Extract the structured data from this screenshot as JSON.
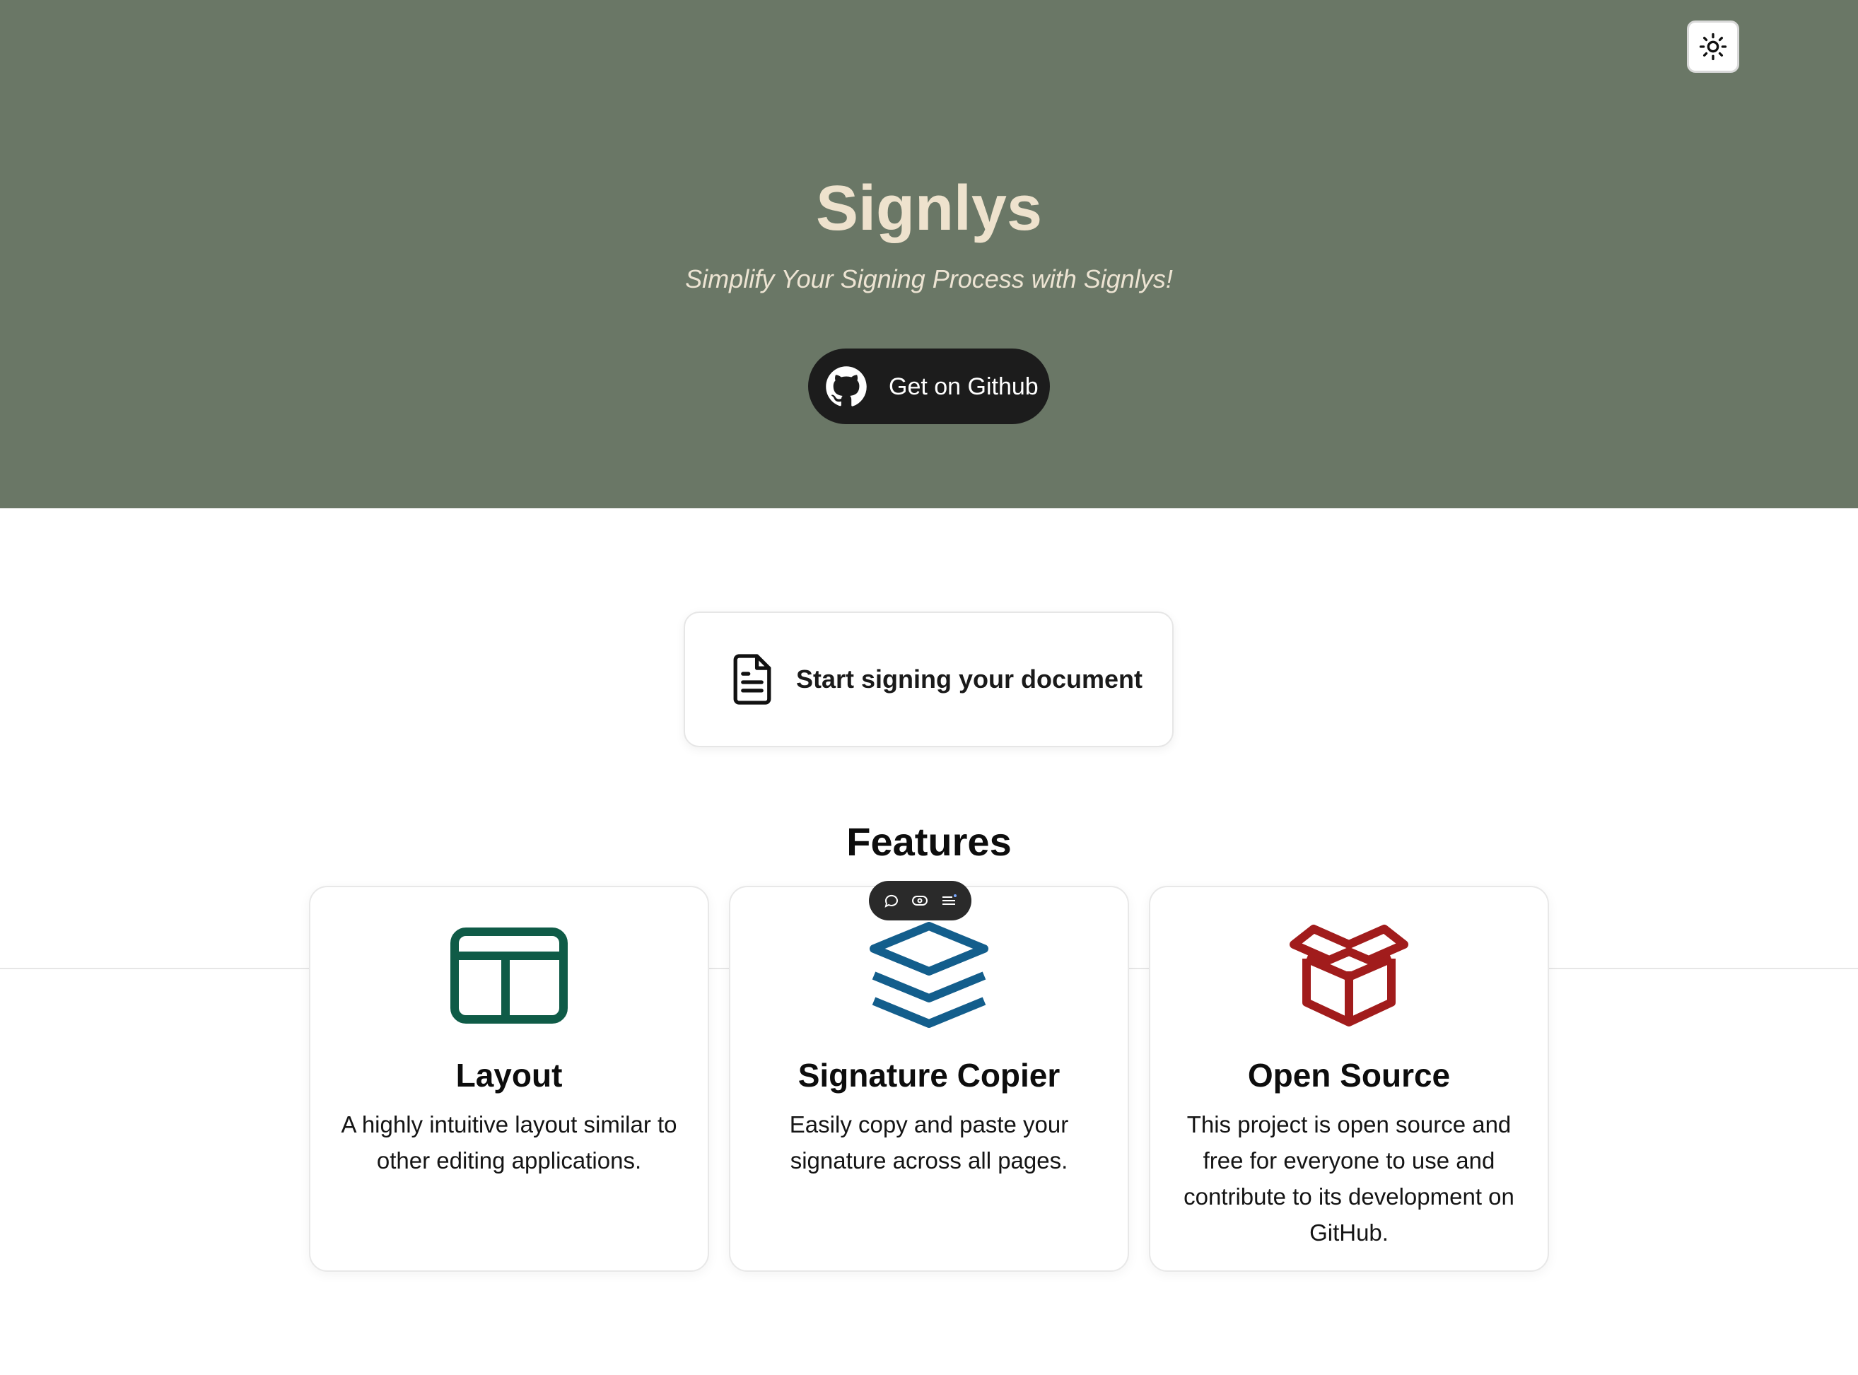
{
  "hero": {
    "title": "Signlys",
    "subtitle": "Simplify Your Signing Process with Signlys!",
    "github_button_label": "Get on Github",
    "background_color": "#6a7766",
    "title_color": "#eee2cd"
  },
  "header": {
    "theme_toggle_icon": "sun-icon"
  },
  "start_card": {
    "label": "Start signing your document",
    "icon": "document-icon"
  },
  "features": {
    "heading": "Features",
    "items": [
      {
        "title": "Layout",
        "description": "A highly intuitive layout similar to other editing applications.",
        "icon": "layout-icon",
        "icon_color": "#0f5b47"
      },
      {
        "title": "Signature Copier",
        "description": "Easily copy and paste your signature across all pages.",
        "icon": "stack-layers-icon",
        "icon_color": "#135e8c"
      },
      {
        "title": "Open Source",
        "description": "This project is open source and free for everyone to use and contribute to its development on GitHub.",
        "icon": "open-box-icon",
        "icon_color": "#a11c1c"
      }
    ]
  },
  "floating_toolbar": {
    "icons": [
      "comment-icon",
      "eye-icon",
      "list-icon"
    ]
  }
}
